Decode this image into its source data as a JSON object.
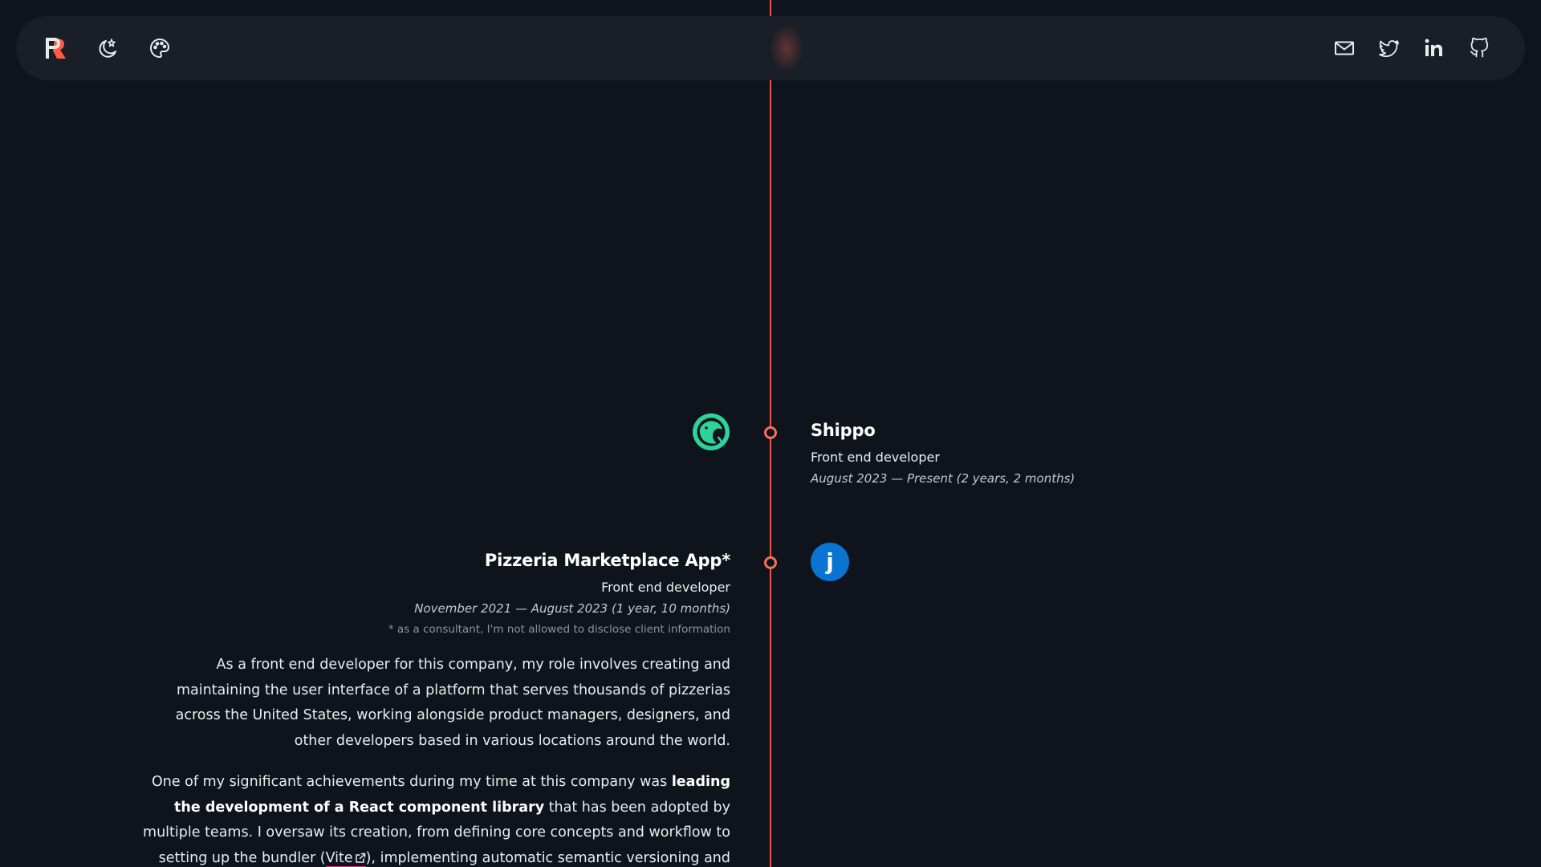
{
  "nav": {
    "logo_icon": "logo-icon",
    "left_icons": [
      "theme-toggle-icon",
      "palette-icon"
    ],
    "right_icons": [
      "mail-icon",
      "twitter-icon",
      "linkedin-icon",
      "github-icon"
    ]
  },
  "colors": {
    "background": "#0f141c",
    "navbar": "#1a1f27",
    "accent": "#e8594a",
    "node": "#f0715f",
    "shippo_logo": "#2fd39a",
    "second_logo": "#0b73d1",
    "link_underline": "#e0337a"
  },
  "timeline": {
    "entries": [
      {
        "company": "Shippo",
        "role": "Front end developer",
        "dates": "August 2023 — Present (2 years, 2 months)",
        "logo_icon": "shippo-logo-icon"
      },
      {
        "company": "Pizzeria Marketplace App*",
        "role": "Front end developer",
        "dates": "November 2021 — August 2023 (1 year, 10 months)",
        "note": "* as a consultant, I'm not allowed to disclose client information",
        "logo_icon": "company-j-logo-icon",
        "logo_letter": "j",
        "description_1": "As a front end developer for this company, my role involves creating and maintaining the user interface of a platform that serves thousands of pizzerias across the United States, working alongside product managers, designers, and other developers based in various locations around the world.",
        "description_2_pre": "One of my significant achievements during my time at this company was ",
        "description_2_bold": "leading the development of a React component library",
        "description_2_mid": " that has been adopted by multiple teams. I oversaw its creation, from defining core concepts and workflow to setting up the bundler (",
        "description_2_link": "Vite",
        "description_2_post": "), implementing automatic semantic versioning and publishing"
      }
    ]
  }
}
